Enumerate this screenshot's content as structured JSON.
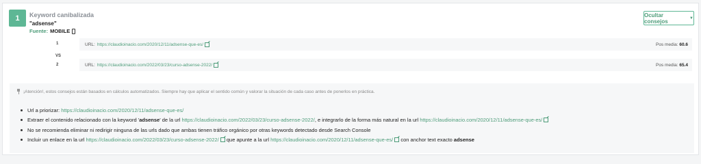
{
  "header": {
    "number": "1",
    "title": "Keyword canibalizada",
    "keyword": "\"adsense\"",
    "source_label": "Fuente:",
    "source_value": "MOBILE",
    "hide_button": "Ocultar consejos"
  },
  "urls": [
    {
      "rank": "1",
      "label": "URL:",
      "url": "https://claudioinacio.com/2020/12/11/adsense-que-es/",
      "pos_label": "Pos media:",
      "pos_value": "60.6"
    },
    {
      "rank": "2",
      "label": "URL:",
      "url": "https://claudioinacio.com/2022/03/23/curso-adsense-2022/",
      "pos_label": "Pos media:",
      "pos_value": "65.4"
    }
  ],
  "vs": "VS",
  "tips": {
    "warning": "¡Atención!, estos consejos están basados en cálculos automatizados. Siempre hay que aplicar el sentido común y valorar la situación de cada caso antes de ponerlos en práctica.",
    "t1_text": "Url a priorizar:",
    "t1_url": "https://claudioinacio.com/2020/12/11/adsense-que-es/",
    "t2_a": "Extraer el contenido relacionado con la keyword '",
    "t2_kw": "adsense",
    "t2_b": "' de la url",
    "t2_url1": "https://claudioinacio.com/2022/03/23/curso-adsense-2022/",
    "t2_c": ", e integrarlo de la forma más natural en la url",
    "t2_url2": "https://claudioinacio.com/2020/12/11/adsense-que-es/",
    "t3": "No se recomienda eliminar ni redirigir ninguna de las urls dado que ambas tienen tráfico orgánico por otras keywords detectado desde Search Console",
    "t4_a": "Incluir un enlace en la url",
    "t4_url1": "https://claudioinacio.com/2022/03/23/curso-adsense-2022/",
    "t4_b": "que apunte a la url",
    "t4_url2": "https://claudioinacio.com/2020/12/11/adsense-que-es/",
    "t4_c": "con anchor text exacto",
    "t4_kw": "adsense"
  }
}
